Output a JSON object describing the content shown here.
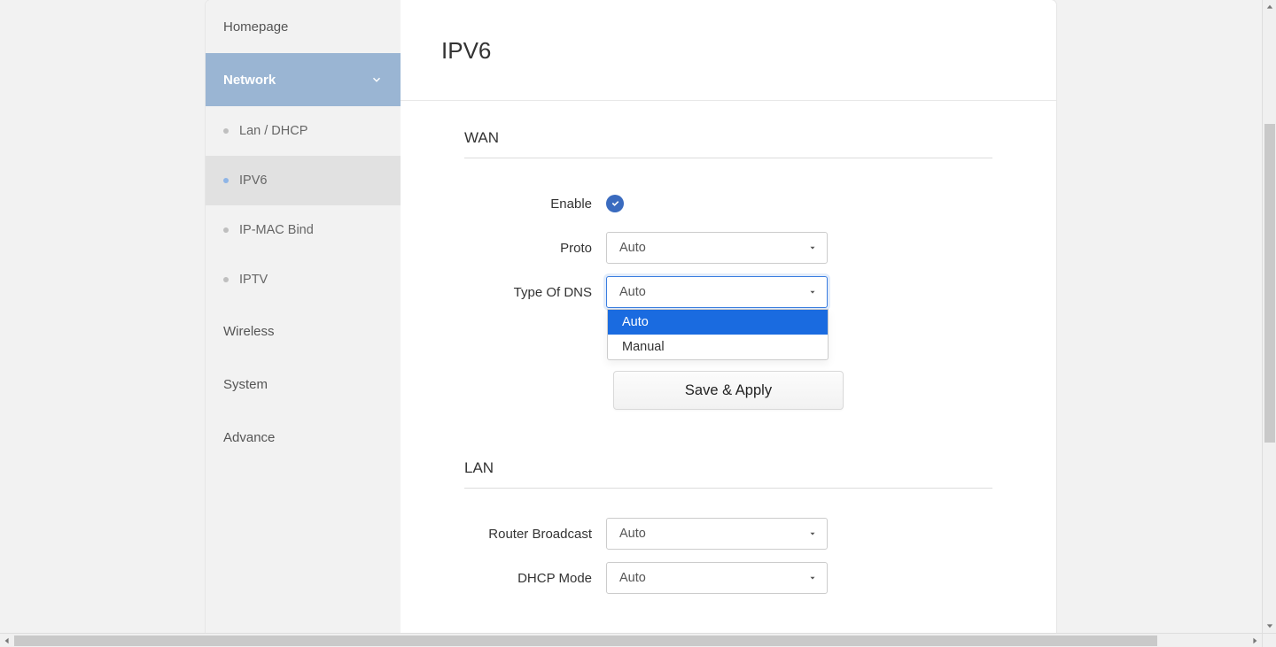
{
  "sidebar": {
    "items": [
      {
        "label": "Homepage"
      },
      {
        "label": "Network",
        "expanded": true
      },
      {
        "label": "Wireless"
      },
      {
        "label": "System"
      },
      {
        "label": "Advance"
      }
    ],
    "network_sub": [
      {
        "label": "Lan / DHCP"
      },
      {
        "label": "IPV6",
        "active": true
      },
      {
        "label": "IP-MAC Bind"
      },
      {
        "label": "IPTV"
      }
    ]
  },
  "page": {
    "title": "IPV6"
  },
  "wan": {
    "title": "WAN",
    "enable_label": "Enable",
    "enable_value": true,
    "proto_label": "Proto",
    "proto_value": "Auto",
    "dns_label": "Type Of DNS",
    "dns_value": "Auto",
    "dns_options": [
      "Auto",
      "Manual"
    ],
    "save_label": "Save & Apply"
  },
  "lan": {
    "title": "LAN",
    "router_broadcast_label": "Router Broadcast",
    "router_broadcast_value": "Auto",
    "dhcp_mode_label": "DHCP Mode",
    "dhcp_mode_value": "Auto"
  }
}
